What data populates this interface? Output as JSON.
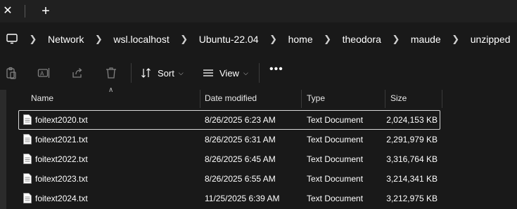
{
  "tabstrip": {
    "close_glyph": "✕",
    "new_tab_glyph": "+"
  },
  "address": {
    "icon": "monitor-icon",
    "crumbs": [
      "Network",
      "wsl.localhost",
      "Ubuntu-22.04",
      "home",
      "theodora",
      "maude",
      "unzipped"
    ]
  },
  "command_bar": {
    "icons": [
      "paste-icon",
      "rename-icon",
      "share-icon",
      "delete-icon"
    ],
    "sort_label": "Sort",
    "view_label": "View",
    "more_label": "•••"
  },
  "columns": {
    "name": "Name",
    "date": "Date modified",
    "type": "Type",
    "size": "Size"
  },
  "files": [
    {
      "name": "foitext2020.txt",
      "date": "8/26/2025 6:23 AM",
      "type": "Text Document",
      "size": "2,024,153 KB"
    },
    {
      "name": "foitext2021.txt",
      "date": "8/26/2025 6:31 AM",
      "type": "Text Document",
      "size": "2,291,979 KB"
    },
    {
      "name": "foitext2022.txt",
      "date": "8/26/2025 6:45 AM",
      "type": "Text Document",
      "size": "3,316,764 KB"
    },
    {
      "name": "foitext2023.txt",
      "date": "8/26/2025 6:55 AM",
      "type": "Text Document",
      "size": "3,214,341 KB"
    },
    {
      "name": "foitext2024.txt",
      "date": "11/25/2025 6:39 AM",
      "type": "Text Document",
      "size": "3,212,975 KB"
    }
  ],
  "colors": {
    "background": "#191919",
    "tabstrip": "#202020",
    "text": "#ffffff",
    "selection_border": "#d8d8d8"
  }
}
